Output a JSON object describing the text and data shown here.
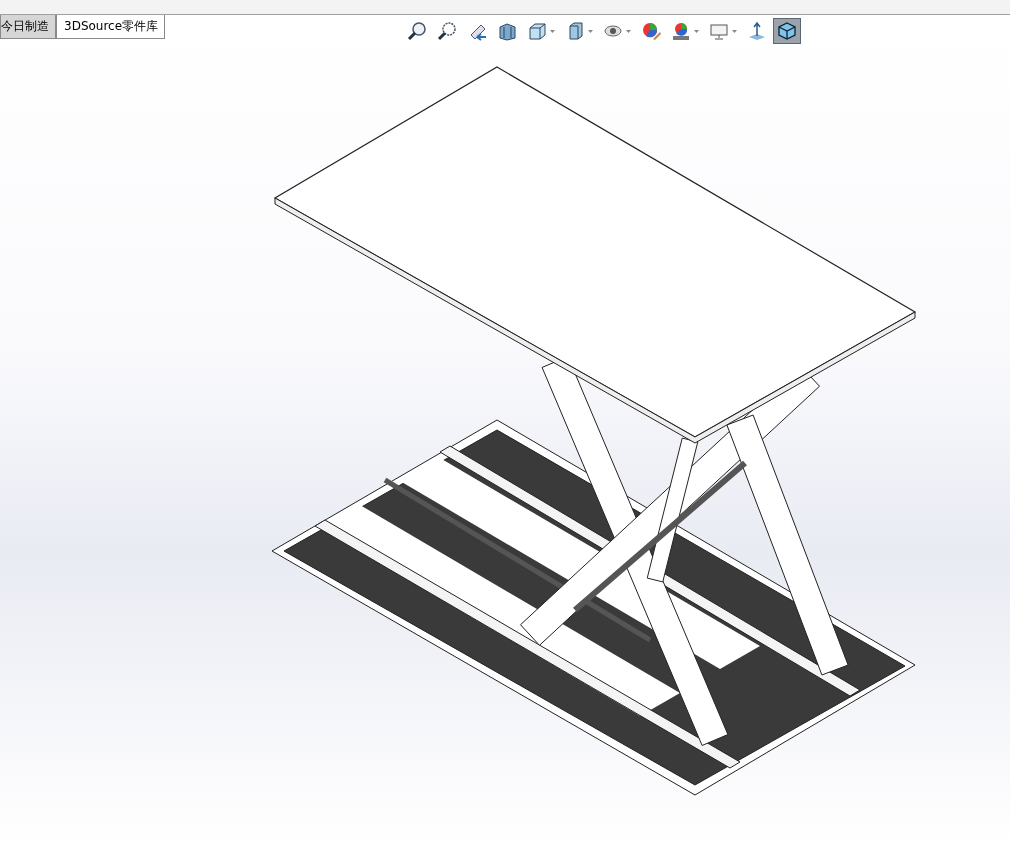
{
  "tabs": [
    {
      "label": "今日制造",
      "selected": false
    },
    {
      "label": "3DSource零件库",
      "selected": true
    }
  ],
  "toolbar": [
    {
      "kind": "zoom-fit",
      "dropdown": false,
      "selected": false
    },
    {
      "kind": "zoom-area",
      "dropdown": false,
      "selected": false
    },
    {
      "kind": "previous-view",
      "dropdown": false,
      "selected": false
    },
    {
      "kind": "section",
      "dropdown": false,
      "selected": false
    },
    {
      "kind": "orientation",
      "dropdown": true,
      "selected": false
    },
    {
      "kind": "display-style",
      "dropdown": true,
      "selected": false
    },
    {
      "kind": "hide-show",
      "dropdown": true,
      "selected": false
    },
    {
      "kind": "appearance",
      "dropdown": false,
      "selected": false
    },
    {
      "kind": "scene",
      "dropdown": true,
      "selected": false
    },
    {
      "kind": "monitor",
      "dropdown": true,
      "selected": false
    },
    {
      "kind": "triad",
      "dropdown": false,
      "selected": false
    },
    {
      "kind": "cube",
      "dropdown": false,
      "selected": true
    }
  ]
}
